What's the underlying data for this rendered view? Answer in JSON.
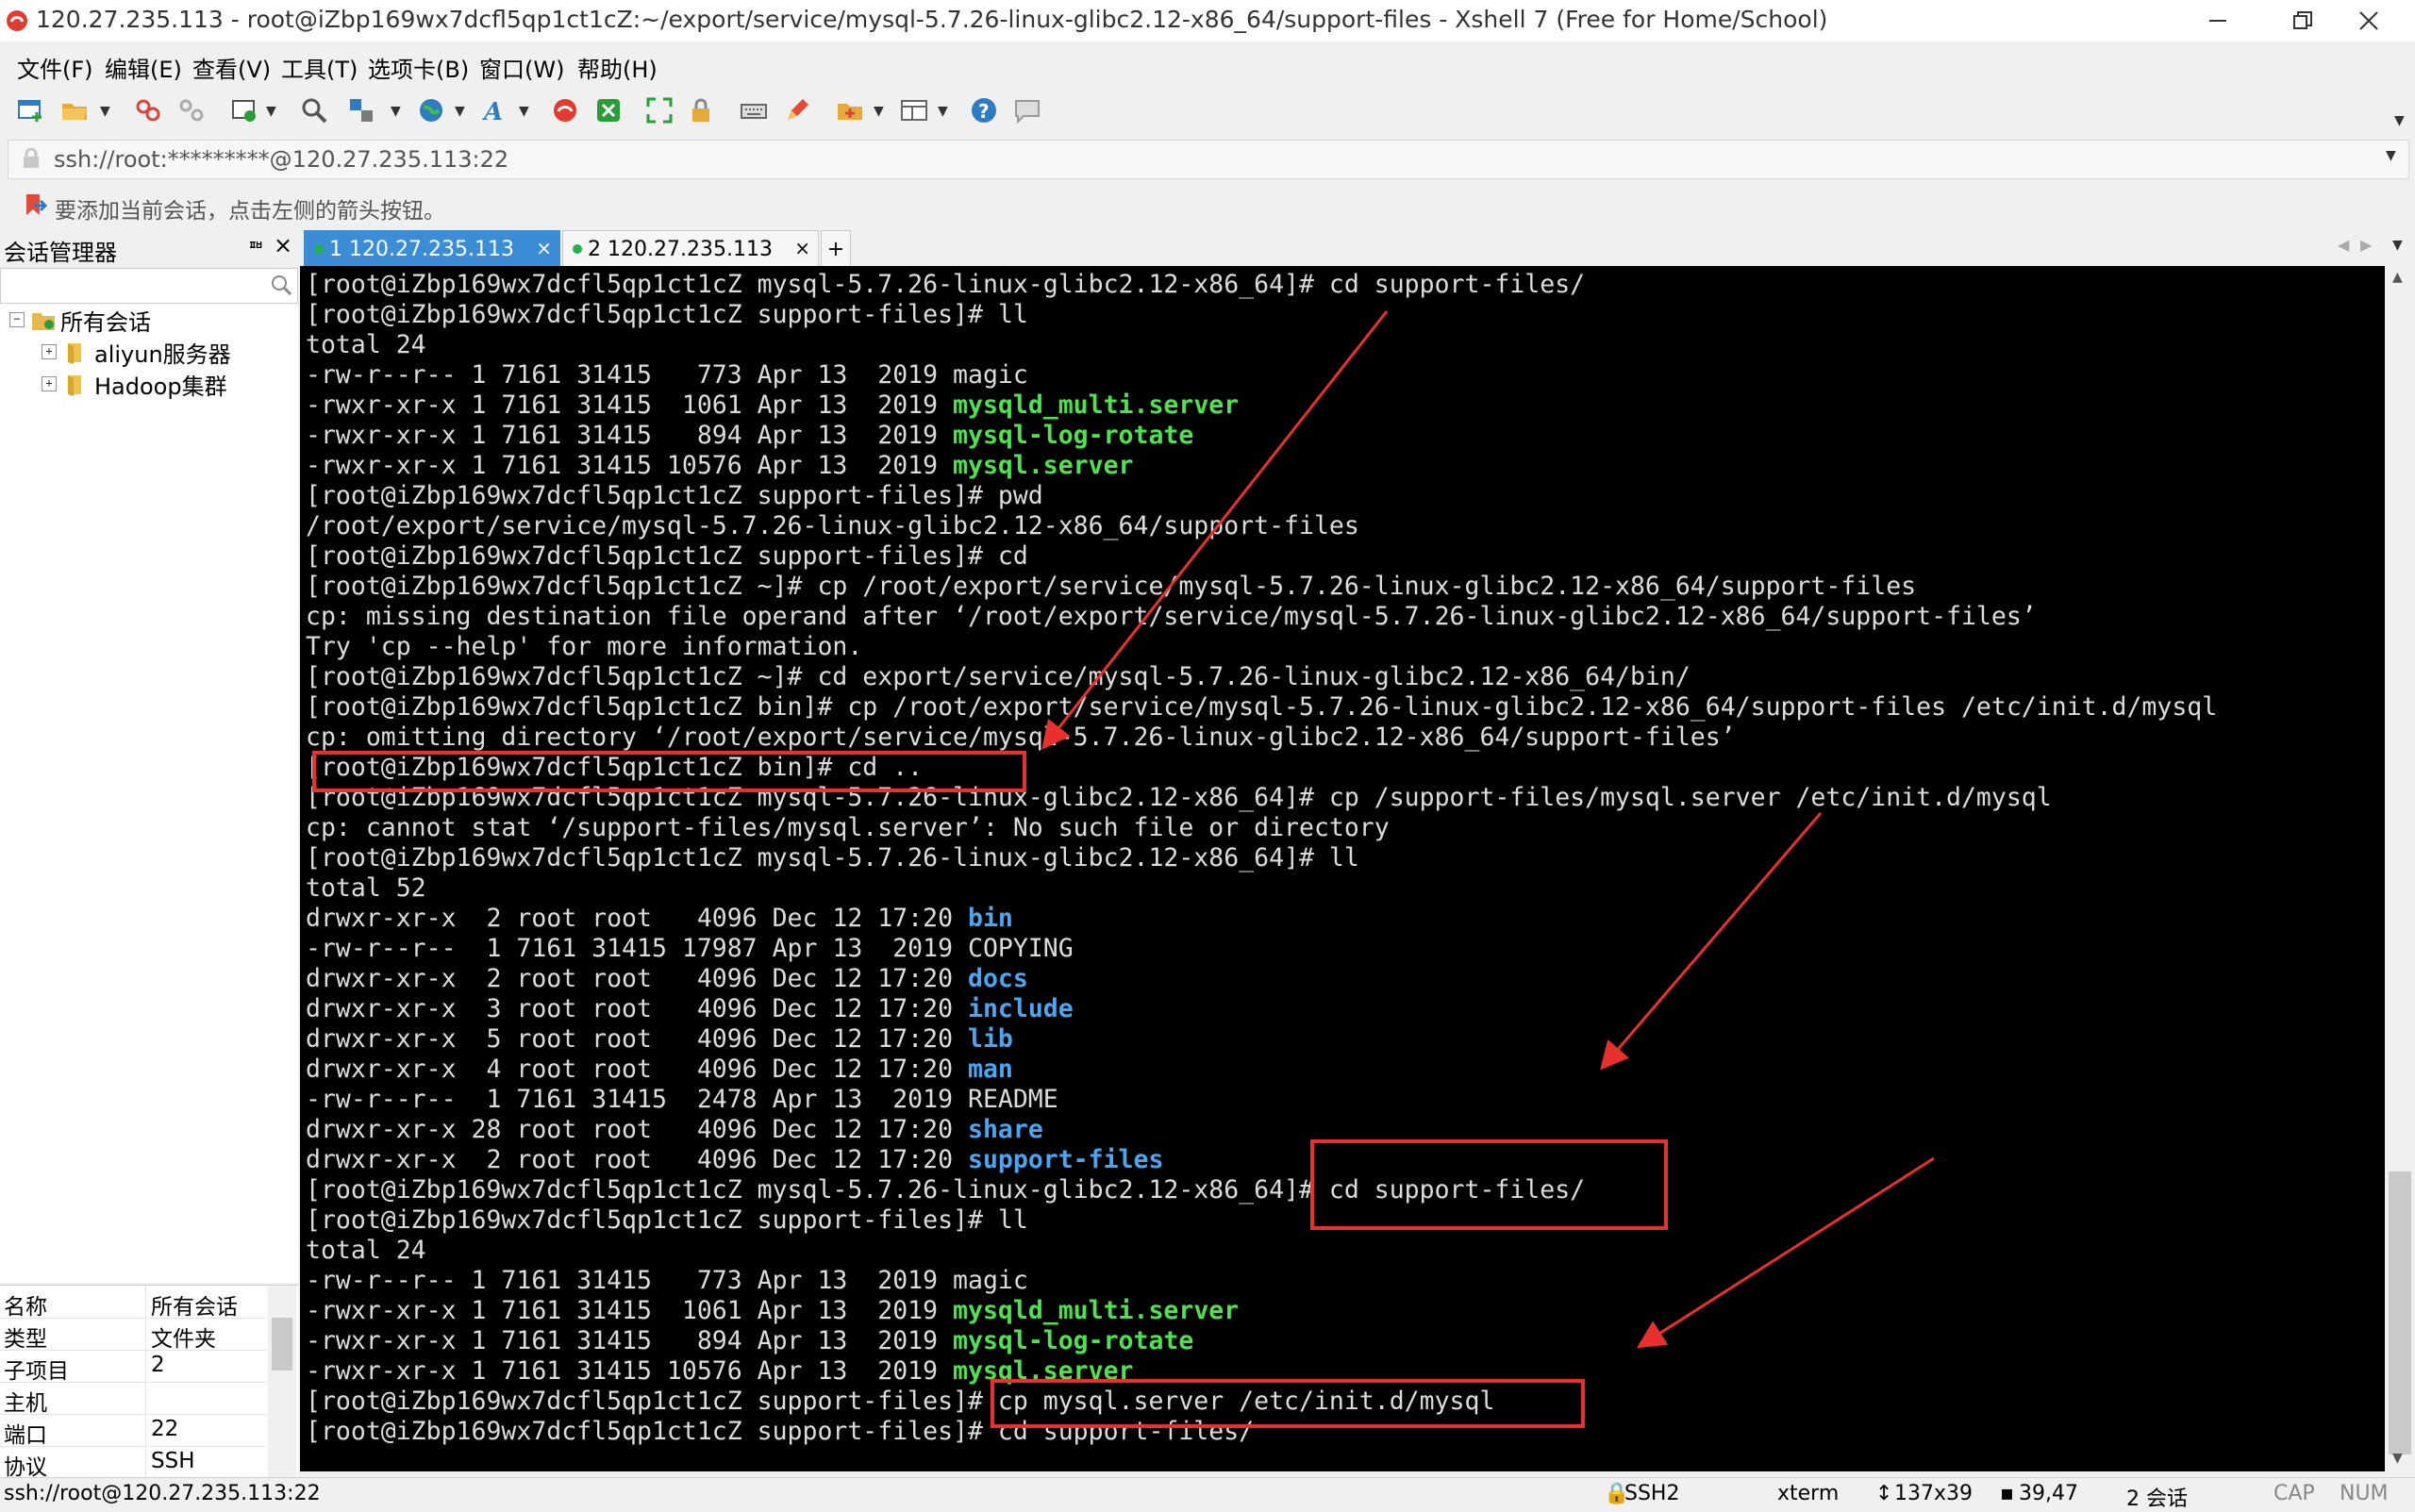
{
  "window": {
    "title": "120.27.235.113 - root@iZbp169wx7dcfl5qp1ct1cZ:~/export/service/mysql-5.7.26-linux-glibc2.12-x86_64/support-files - Xshell 7 (Free for Home/School)"
  },
  "menu": {
    "items": [
      "文件(F)",
      "编辑(E)",
      "查看(V)",
      "工具(T)",
      "选项卡(B)",
      "窗口(W)",
      "帮助(H)"
    ]
  },
  "address": {
    "text": "ssh://root:*********@120.27.235.113:22"
  },
  "hint": {
    "text": "要添加当前会话，点击左侧的箭头按钮。"
  },
  "session_manager": {
    "title": "会话管理器",
    "pin": "ᅖ",
    "close": "×",
    "search_placeholder": "",
    "tree": {
      "root": "所有会话",
      "children": [
        "aliyun服务器",
        "Hadoop集群"
      ]
    },
    "properties": [
      {
        "key": "名称",
        "value": "所有会话"
      },
      {
        "key": "类型",
        "value": "文件夹"
      },
      {
        "key": "子项目",
        "value": "2"
      },
      {
        "key": "主机",
        "value": ""
      },
      {
        "key": "端口",
        "value": "22"
      },
      {
        "key": "协议",
        "value": "SSH"
      }
    ]
  },
  "tabs": [
    {
      "label": "1 120.27.235.113",
      "active": true
    },
    {
      "label": "2 120.27.235.113",
      "active": false
    }
  ],
  "tab_add": "+",
  "terminal": {
    "lines": [
      [
        {
          "t": "[root@iZbp169wx7dcfl5qp1ct1cZ mysql-5.7.26-linux-glibc2.12-x86_64]# cd support-files/"
        }
      ],
      [
        {
          "t": "[root@iZbp169wx7dcfl5qp1ct1cZ support-files]# ll"
        }
      ],
      [
        {
          "t": "total 24"
        }
      ],
      [
        {
          "t": "-rw-r--r-- 1 7161 31415   773 Apr 13  2019 magic"
        }
      ],
      [
        {
          "t": "-rwxr-xr-x 1 7161 31415  1061 Apr 13  2019 "
        },
        {
          "t": "mysqld_multi.server",
          "c": "green"
        }
      ],
      [
        {
          "t": "-rwxr-xr-x 1 7161 31415   894 Apr 13  2019 "
        },
        {
          "t": "mysql-log-rotate",
          "c": "green"
        }
      ],
      [
        {
          "t": "-rwxr-xr-x 1 7161 31415 10576 Apr 13  2019 "
        },
        {
          "t": "mysql.server",
          "c": "green"
        }
      ],
      [
        {
          "t": "[root@iZbp169wx7dcfl5qp1ct1cZ support-files]# pwd"
        }
      ],
      [
        {
          "t": "/root/export/service/mysql-5.7.26-linux-glibc2.12-x86_64/support-files"
        }
      ],
      [
        {
          "t": "[root@iZbp169wx7dcfl5qp1ct1cZ support-files]# cd"
        }
      ],
      [
        {
          "t": "[root@iZbp169wx7dcfl5qp1ct1cZ ~]# cp /root/export/service/mysql-5.7.26-linux-glibc2.12-x86_64/support-files"
        }
      ],
      [
        {
          "t": "cp: missing destination file operand after ‘/root/export/service/mysql-5.7.26-linux-glibc2.12-x86_64/support-files’"
        }
      ],
      [
        {
          "t": "Try 'cp --help' for more information."
        }
      ],
      [
        {
          "t": "[root@iZbp169wx7dcfl5qp1ct1cZ ~]# cd export/service/mysql-5.7.26-linux-glibc2.12-x86_64/bin/"
        }
      ],
      [
        {
          "t": "[root@iZbp169wx7dcfl5qp1ct1cZ bin]# cp /root/export/service/mysql-5.7.26-linux-glibc2.12-x86_64/support-files /etc/init.d/mysql"
        }
      ],
      [
        {
          "t": "cp: omitting directory ‘/root/export/service/mysql-5.7.26-linux-glibc2.12-x86_64/support-files’"
        }
      ],
      [
        {
          "t": "[root@iZbp169wx7dcfl5qp1ct1cZ bin]# cd .."
        }
      ],
      [
        {
          "t": "[root@iZbp169wx7dcfl5qp1ct1cZ mysql-5.7.26-linux-glibc2.12-x86_64]# cp /support-files/mysql.server /etc/init.d/mysql"
        }
      ],
      [
        {
          "t": "cp: cannot stat ‘/support-files/mysql.server’: No such file or directory"
        }
      ],
      [
        {
          "t": "[root@iZbp169wx7dcfl5qp1ct1cZ mysql-5.7.26-linux-glibc2.12-x86_64]# ll"
        }
      ],
      [
        {
          "t": "total 52"
        }
      ],
      [
        {
          "t": "drwxr-xr-x  2 root root   4096 Dec 12 17:20 "
        },
        {
          "t": "bin",
          "c": "blue"
        }
      ],
      [
        {
          "t": "-rw-r--r--  1 7161 31415 17987 Apr 13  2019 COPYING"
        }
      ],
      [
        {
          "t": "drwxr-xr-x  2 root root   4096 Dec 12 17:20 "
        },
        {
          "t": "docs",
          "c": "blue"
        }
      ],
      [
        {
          "t": "drwxr-xr-x  3 root root   4096 Dec 12 17:20 "
        },
        {
          "t": "include",
          "c": "blue"
        }
      ],
      [
        {
          "t": "drwxr-xr-x  5 root root   4096 Dec 12 17:20 "
        },
        {
          "t": "lib",
          "c": "blue"
        }
      ],
      [
        {
          "t": "drwxr-xr-x  4 root root   4096 Dec 12 17:20 "
        },
        {
          "t": "man",
          "c": "blue"
        }
      ],
      [
        {
          "t": "-rw-r--r--  1 7161 31415  2478 Apr 13  2019 README"
        }
      ],
      [
        {
          "t": "drwxr-xr-x 28 root root   4096 Dec 12 17:20 "
        },
        {
          "t": "share",
          "c": "blue"
        }
      ],
      [
        {
          "t": "drwxr-xr-x  2 root root   4096 Dec 12 17:20 "
        },
        {
          "t": "support-files",
          "c": "blue"
        }
      ],
      [
        {
          "t": "[root@iZbp169wx7dcfl5qp1ct1cZ mysql-5.7.26-linux-glibc2.12-x86_64]# cd support-files/"
        }
      ],
      [
        {
          "t": "[root@iZbp169wx7dcfl5qp1ct1cZ support-files]# ll"
        }
      ],
      [
        {
          "t": "total 24"
        }
      ],
      [
        {
          "t": "-rw-r--r-- 1 7161 31415   773 Apr 13  2019 magic"
        }
      ],
      [
        {
          "t": "-rwxr-xr-x 1 7161 31415  1061 Apr 13  2019 "
        },
        {
          "t": "mysqld_multi.server",
          "c": "green"
        }
      ],
      [
        {
          "t": "-rwxr-xr-x 1 7161 31415   894 Apr 13  2019 "
        },
        {
          "t": "mysql-log-rotate",
          "c": "green"
        }
      ],
      [
        {
          "t": "-rwxr-xr-x 1 7161 31415 10576 Apr 13  2019 "
        },
        {
          "t": "mysql.server",
          "c": "green"
        }
      ],
      [
        {
          "t": "[root@iZbp169wx7dcfl5qp1ct1cZ support-files]# cp mysql.server /etc/init.d/mysql"
        }
      ],
      [
        {
          "t": "[root@iZbp169wx7dcfl5qp1ct1cZ support-files]# cd support-files/"
        }
      ]
    ]
  },
  "annotation_color": "#e8302c",
  "statusbar": {
    "connection": "ssh://root@120.27.235.113:22",
    "protocol": "SSH2",
    "term": "xterm",
    "size": "137x39",
    "cursor": "39,47",
    "sessions": "2 会话",
    "caps": "CAP",
    "num": "NUM"
  }
}
